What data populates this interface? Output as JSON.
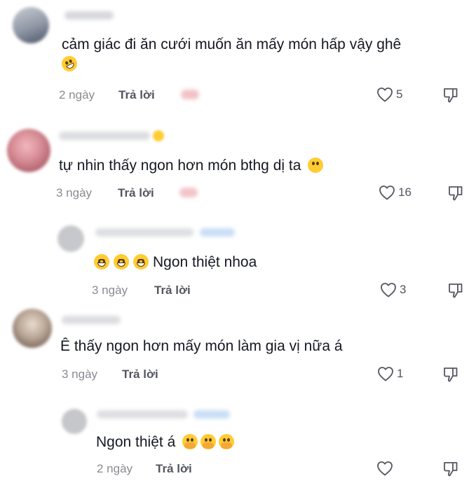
{
  "comments": [
    {
      "text": "cảm giác đi ăn cưới muốn ăn mấy món hấp vậy ghê",
      "emoji": "rolling-on-floor-laughing",
      "time": "2 ngày",
      "reply_label": "Trả lời",
      "likes": "5"
    },
    {
      "text": "tự nhin thấy ngon hơn món bthg dị ta",
      "emoji": "pleading-face",
      "time": "3 ngày",
      "reply_label": "Trả lời",
      "likes": "16"
    },
    {
      "text": "Ngon thiệt nhoa",
      "emoji": "grinning-face",
      "time": "3 ngày",
      "reply_label": "Trả lời",
      "likes": "3"
    },
    {
      "text": "Ê thấy ngon hơn mấy món làm gia vị nữa á",
      "time": "3 ngày",
      "reply_label": "Trả lời",
      "likes": "1"
    },
    {
      "text": "Ngon thiệt á",
      "emoji": "face-with-hand-over-mouth",
      "time": "2 ngày",
      "reply_label": "Trả lời",
      "likes": ""
    }
  ],
  "icons": {
    "like": "heart-outline-icon",
    "dislike": "thumbs-down-icon"
  },
  "colors": {
    "text": "#161823",
    "meta": "#8a8b91",
    "reply": "#545660"
  }
}
